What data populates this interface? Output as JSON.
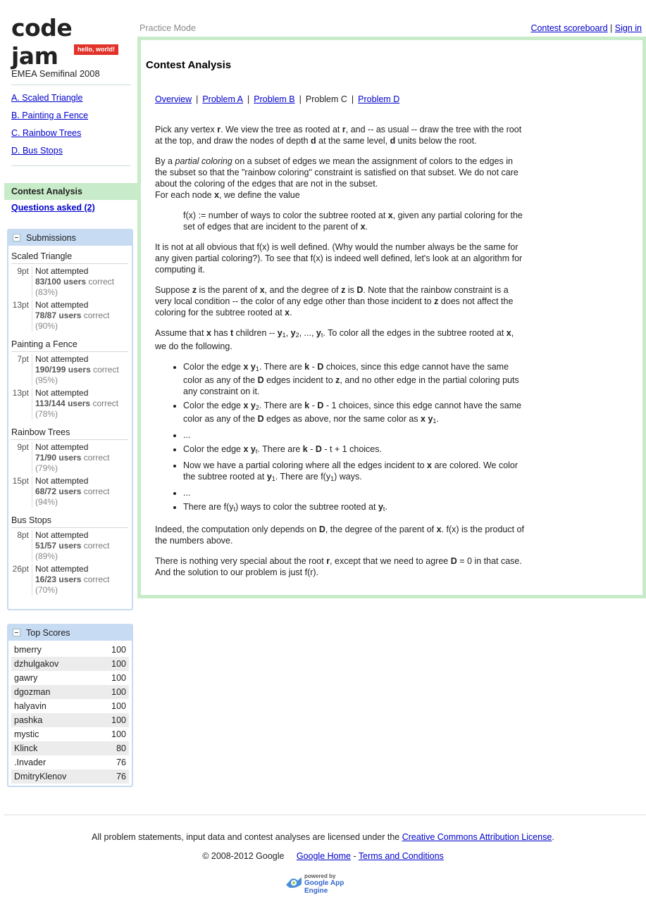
{
  "logo": {
    "word": "code jam",
    "tagline": "hello, world!"
  },
  "header": {
    "mode": "Practice Mode",
    "scoreboard_link": "Contest scoreboard",
    "separator": "|",
    "signin_link": "Sign in"
  },
  "sidebar": {
    "contest_name": "EMEA Semifinal 2008",
    "problems": [
      "A. Scaled Triangle",
      "B. Painting a Fence",
      "C. Rainbow Trees",
      "D. Bus Stops"
    ],
    "analysis_label": "Contest Analysis",
    "questions_label": "Questions asked (2)"
  },
  "submissions": {
    "title": "Submissions",
    "problems": [
      {
        "name": "Scaled Triangle",
        "rows": [
          {
            "pts": "9pt",
            "status": "Not attempted",
            "solved": "83/100",
            "users": "users",
            "correct": "correct",
            "pct": "(83%)"
          },
          {
            "pts": "13pt",
            "status": "Not attempted",
            "solved": "78/87",
            "users": "users",
            "correct": "correct",
            "pct": "(90%)"
          }
        ]
      },
      {
        "name": "Painting a Fence",
        "rows": [
          {
            "pts": "7pt",
            "status": "Not attempted",
            "solved": "190/199",
            "users": "users",
            "correct": "correct",
            "pct": "(95%)"
          },
          {
            "pts": "13pt",
            "status": "Not attempted",
            "solved": "113/144",
            "users": "users",
            "correct": "correct",
            "pct": "(78%)"
          }
        ]
      },
      {
        "name": "Rainbow Trees",
        "rows": [
          {
            "pts": "9pt",
            "status": "Not attempted",
            "solved": "71/90",
            "users": "users",
            "correct": "correct",
            "pct": "(79%)"
          },
          {
            "pts": "15pt",
            "status": "Not attempted",
            "solved": "68/72",
            "users": "users",
            "correct": "correct",
            "pct": "(94%)"
          }
        ]
      },
      {
        "name": "Bus Stops",
        "rows": [
          {
            "pts": "8pt",
            "status": "Not attempted",
            "solved": "51/57",
            "users": "users",
            "correct": "correct",
            "pct": "(89%)"
          },
          {
            "pts": "26pt",
            "status": "Not attempted",
            "solved": "16/23",
            "users": "users",
            "correct": "correct",
            "pct": "(70%)"
          }
        ]
      }
    ]
  },
  "top_scores": {
    "title": "Top Scores",
    "rows": [
      {
        "name": "bmerry",
        "score": "100"
      },
      {
        "name": "dzhulgakov",
        "score": "100"
      },
      {
        "name": "gawry",
        "score": "100"
      },
      {
        "name": "dgozman",
        "score": "100"
      },
      {
        "name": "halyavin",
        "score": "100"
      },
      {
        "name": "pashka",
        "score": "100"
      },
      {
        "name": "mystic",
        "score": "100"
      },
      {
        "name": "Klinck",
        "score": "80"
      },
      {
        "name": ".Invader",
        "score": "76"
      },
      {
        "name": "DmitryKlenov",
        "score": "76"
      }
    ]
  },
  "main": {
    "title": "Contest Analysis",
    "tabs": {
      "overview": "Overview",
      "a": "Problem A",
      "b": "Problem B",
      "c": "Problem C",
      "d": "Problem D",
      "sep": "|"
    }
  },
  "footer": {
    "license_text": "All problem statements, input data and contest analyses are licensed under the",
    "license_link": "Creative Commons Attribution License",
    "license_end": ".",
    "copyright": "© 2008-2012 Google",
    "google_home": "Google Home",
    "dash": "-",
    "terms": "Terms and Conditions",
    "powered_by": "powered by",
    "google": "Google",
    "app_engine": "App Engine"
  }
}
